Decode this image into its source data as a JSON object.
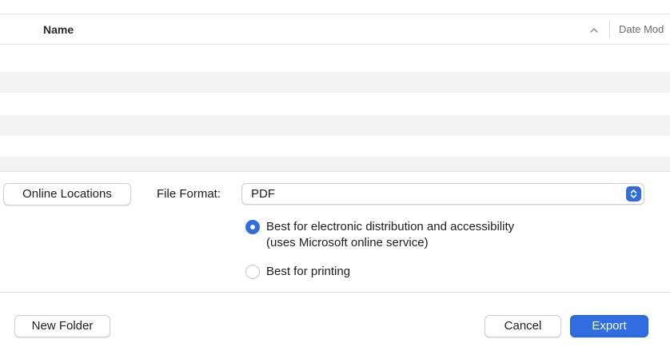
{
  "file_list": {
    "columns": [
      {
        "label": "Name",
        "sorted": "ascending"
      },
      {
        "label": "Date Mod"
      }
    ]
  },
  "options": {
    "online_locations_label": "Online Locations",
    "file_format_label": "File Format:",
    "file_format_value": "PDF",
    "radio_options": [
      {
        "label_line1": "Best for electronic distribution and accessibility",
        "label_line2": "(uses Microsoft online service)",
        "selected": true
      },
      {
        "label_line1": "Best for printing",
        "selected": false
      }
    ]
  },
  "footer": {
    "new_folder_label": "New Folder",
    "cancel_label": "Cancel",
    "export_label": "Export"
  },
  "colors": {
    "accent": "#2f6de1",
    "row_alt": "#f3f3f3"
  },
  "icons": {
    "sort": "chevron-up-icon",
    "stepper": "up-down-stepper-icon"
  }
}
